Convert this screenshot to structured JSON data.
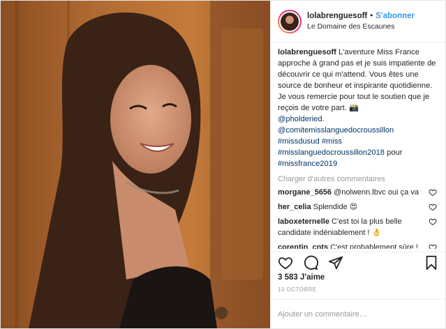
{
  "post": {
    "username": "lolabrenguesoff",
    "follow_label": "S'abonner",
    "location": "Le Domaine des Escaunes",
    "photo_alt": "Portrait photo"
  },
  "caption": {
    "username": "lolabrenguesoff",
    "text": "L'aventure Miss France approche à grand pas et je suis impatiente de découvrir ce qui m'attend. Vous êtes une source de bonheur et inspirante quotidienne. Je vous remercie pour tout le soutien que je reçois de votre part. 📸",
    "tags": [
      "@pholderied.",
      "@comitemisslanguedocroussillon",
      "#missdusud",
      "#miss",
      "#misslanguedocroussillon2018",
      "pour",
      "#missfrance2019"
    ]
  },
  "load_more_label": "Charger d'autres commentaires",
  "comments": [
    {
      "user": "morgane_5656",
      "text": "@nolwenn.lbvc oui ça va"
    },
    {
      "user": "her_celia",
      "text": "Splendide 😍"
    },
    {
      "user": "laboxeternelle",
      "text": "C'est toi la plus belle candidate indéniablement ! 👌"
    },
    {
      "user": "corentin_cnts",
      "text": "C'est probablement sûre ! Elle va être miss France en touche du"
    }
  ],
  "likes_label": "3 583 J'aime",
  "date_label": "10 OCTOBRE",
  "add_comment_placeholder": "Ajouter un commentaire…",
  "icons": {
    "like": "heart-icon",
    "comment": "comment-icon",
    "share": "share-icon",
    "save": "bookmark-icon"
  },
  "colors": {
    "link": "#3897f0",
    "tag": "#003569",
    "muted": "#999999",
    "text": "#262626"
  }
}
